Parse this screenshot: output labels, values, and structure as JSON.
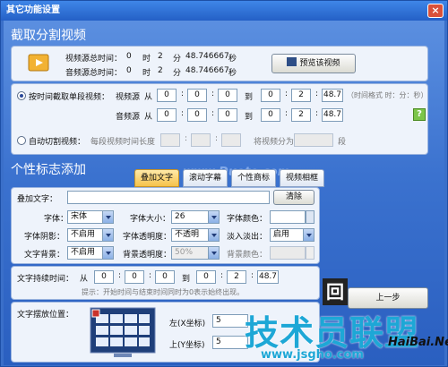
{
  "window": {
    "title": "其它功能设置",
    "close": "×"
  },
  "section1": {
    "title": "截取分割视频",
    "video_total_label": "视频源总时间：",
    "video_total_h": "0",
    "video_total_h_unit": "时",
    "video_total_m": "2",
    "video_total_m_unit": "分",
    "video_total_s": "48.746667",
    "video_total_s_unit": "秒",
    "audio_total_label": "音频源总时间：",
    "audio_total_h": "0",
    "audio_total_h_unit": "时",
    "audio_total_m": "2",
    "audio_total_m_unit": "分",
    "audio_total_s": "48.746667",
    "audio_total_s_unit": "秒",
    "preview_button": "预览该视频",
    "mode_time_label": "按时间截取单段视频：",
    "video_src": "视频源",
    "audio_src": "音频源",
    "from": "从",
    "to": "到",
    "v_from": [
      "0",
      "0",
      "0"
    ],
    "v_to": [
      "0",
      "2",
      "48.7"
    ],
    "a_from": [
      "0",
      "0",
      "0"
    ],
    "a_to": [
      "0",
      "2",
      "48.7"
    ],
    "time_format": "（时间格式 时：分：秒）",
    "help": "?",
    "mode_auto_label": "自动切割视频：",
    "each_len": "每段视频时间长度",
    "split_into": "将视频分为",
    "segments_unit": "段"
  },
  "section2": {
    "title": "个性标志添加",
    "tabs": [
      "叠加文字",
      "滚动字幕",
      "个性商标",
      "视频相框"
    ],
    "overlay_label": "叠加文字：",
    "overlay_value": "",
    "clear_button": "清除",
    "font_label": "字体：",
    "font_value": "宋体",
    "font_size_label": "字体大小：",
    "font_size_value": "26",
    "font_color_label": "字体颜色：",
    "shadow_label": "字体阴影：",
    "shadow_value": "不启用",
    "opacity_label": "字体透明度：",
    "opacity_value": "不透明",
    "fade_label": "淡入淡出：",
    "fade_value": "启用",
    "bg_label": "文字背景：",
    "bg_value": "不启用",
    "bg_opacity_label": "背景透明度：",
    "bg_opacity_value": "50%",
    "bg_color_label": "背景颜色：",
    "duration_label": "文字持续时间：",
    "from": "从",
    "to": "到",
    "d_from": [
      "0",
      "0",
      "0"
    ],
    "d_to": [
      "0",
      "2",
      "48.7"
    ],
    "hint": "提示：开始时间与结束时间同时为0表示始终出现。",
    "pos_label": "文字摆放位置：",
    "left_label": "左(X坐标)",
    "left_value": "5",
    "top_label": "上(Y坐标)",
    "top_value": "5",
    "prev_button": "上一步"
  },
  "watermarks": {
    "mid": "www.Duote.com",
    "big": "技术员联盟",
    "url": "www.jsgho.com",
    "brand": "HaiBai.Net"
  }
}
